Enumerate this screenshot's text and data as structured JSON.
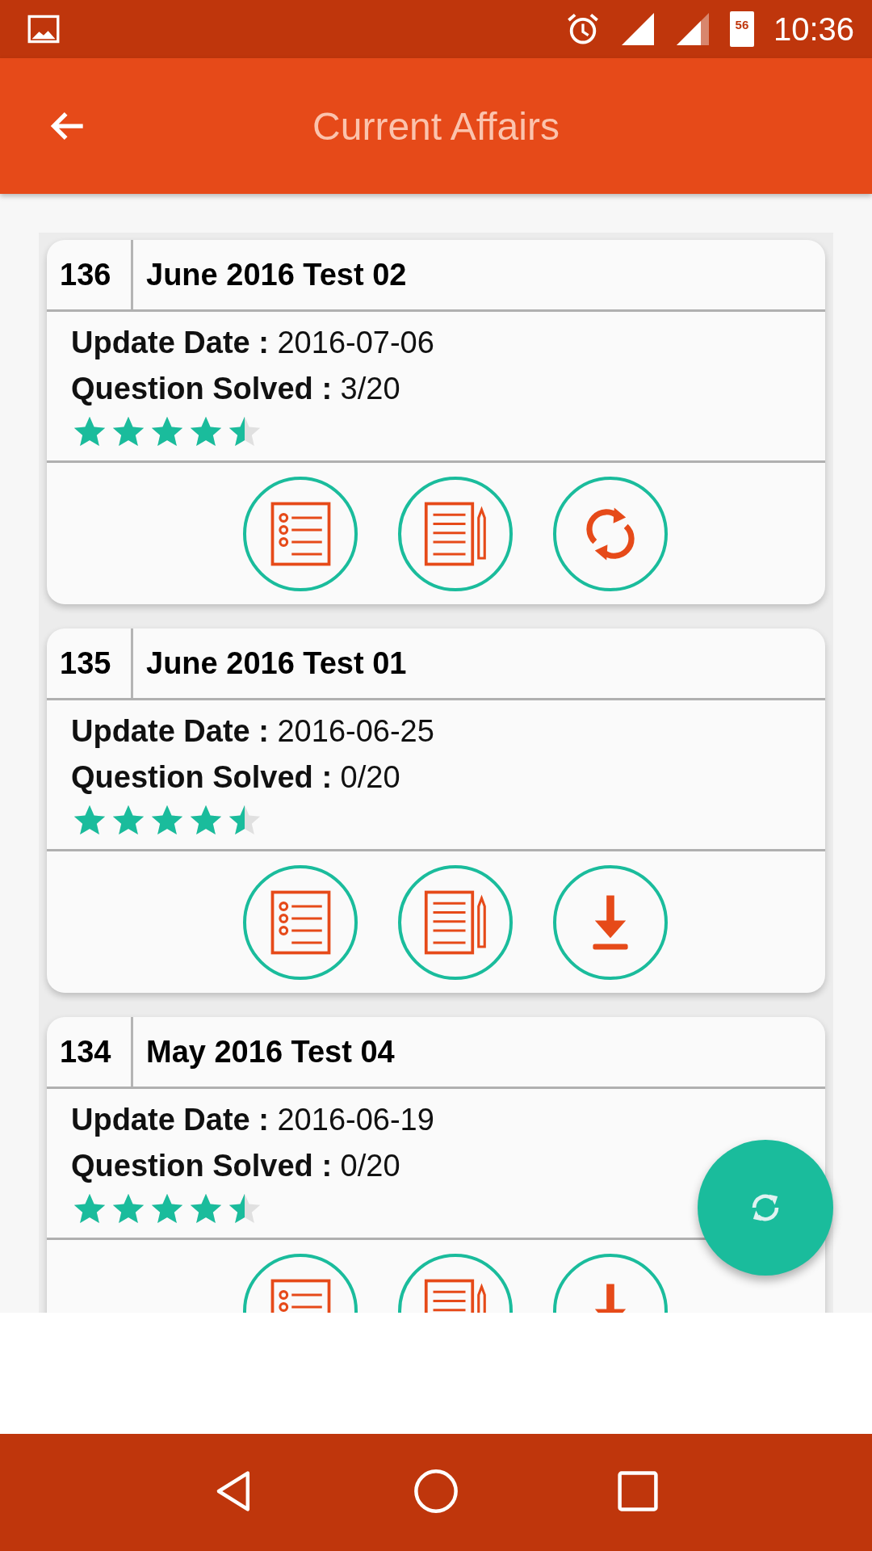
{
  "status_bar": {
    "battery": "56",
    "time": "10:36"
  },
  "app_bar": {
    "title": "Current Affairs"
  },
  "cards": [
    {
      "number": "136",
      "title": "June 2016 Test 02",
      "date_label": "Update Date :",
      "date": "2016-07-06",
      "solved_label": "Question Solved :",
      "solved": "3/20",
      "stars": 4.5,
      "actions": [
        {
          "kind": "list"
        },
        {
          "kind": "notes"
        },
        {
          "kind": "update"
        }
      ]
    },
    {
      "number": "135",
      "title": "June 2016 Test 01",
      "date_label": "Update Date :",
      "date": "2016-06-25",
      "solved_label": "Question Solved :",
      "solved": "0/20",
      "stars": 4.5,
      "actions": [
        {
          "kind": "list"
        },
        {
          "kind": "notes"
        },
        {
          "kind": "download"
        }
      ]
    },
    {
      "number": "134",
      "title": "May 2016 Test 04",
      "date_label": "Update Date :",
      "date": "2016-06-19",
      "solved_label": "Question Solved :",
      "solved": "0/20",
      "stars": 4.5,
      "actions": [
        {
          "kind": "list"
        },
        {
          "kind": "notes"
        },
        {
          "kind": "download"
        }
      ]
    }
  ]
}
